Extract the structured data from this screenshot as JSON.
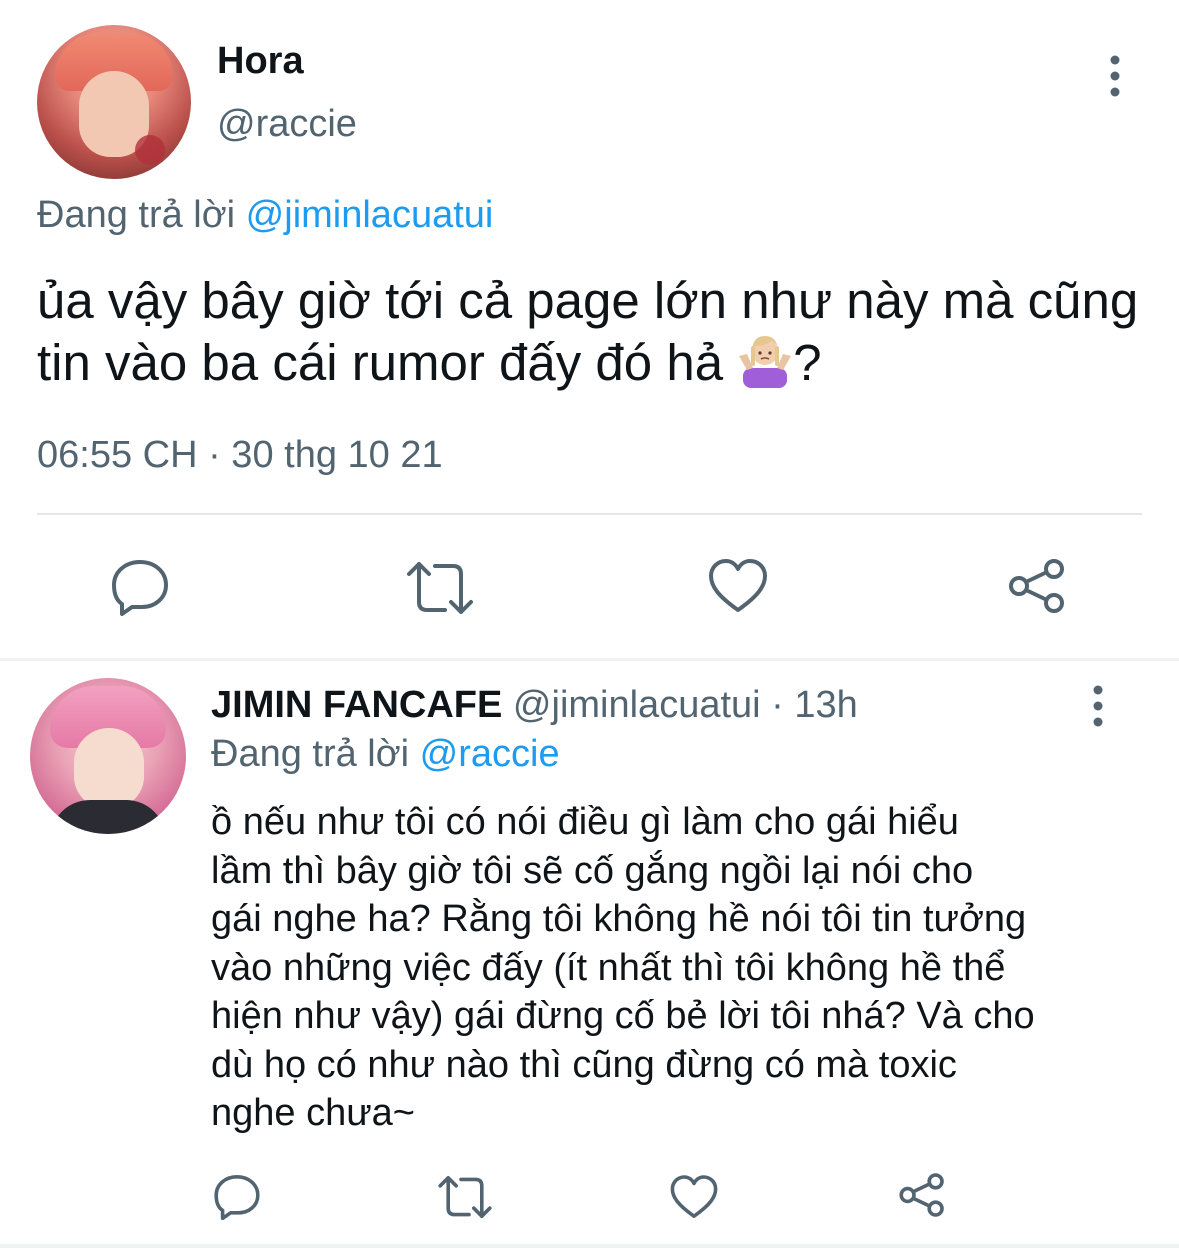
{
  "main_tweet": {
    "author_name": "Hora",
    "author_handle": "@raccie",
    "replying_prefix": "Đang trả lời",
    "replying_to": "@jiminlacuatui",
    "text": "ủa vậy bây giờ tới cả page lớn như này mà cũng tin vào ba cái rumor đấy đó hả",
    "text_suffix": "?",
    "emoji": "person-shrugging-emoji",
    "timestamp": "06:55 CH · 30 thg 10 21",
    "actions": [
      "reply-icon",
      "retweet-icon",
      "like-icon",
      "share-icon"
    ]
  },
  "reply_tweet": {
    "author_name": "JIMIN FANCAFE",
    "author_handle": "@jiminlacuatui",
    "time_ago": "· 13h",
    "replying_prefix": "Đang trả lời",
    "replying_to": "@raccie",
    "text_lines": [
      "ồ nếu như tôi có nói điều gì làm cho gái hiểu",
      "lầm thì bây giờ tôi sẽ cố gắng ngồi lại nói cho",
      "gái nghe ha? Rằng tôi không hề nói tôi tin tưởng",
      "vào những việc đấy (ít nhất thì tôi không hề thể",
      "hiện như vậy) gái đừng cố bẻ lời tôi nhá? Và cho",
      "dù họ có như nào thì cũng đừng có mà toxic",
      "nghe chưa~"
    ],
    "actions": [
      "reply-icon",
      "retweet-icon",
      "like-icon",
      "share-icon"
    ]
  },
  "colors": {
    "primary_text": "#0f1419",
    "secondary_text": "#536471",
    "link": "#1d9bf0",
    "divider": "#eff3f4"
  }
}
